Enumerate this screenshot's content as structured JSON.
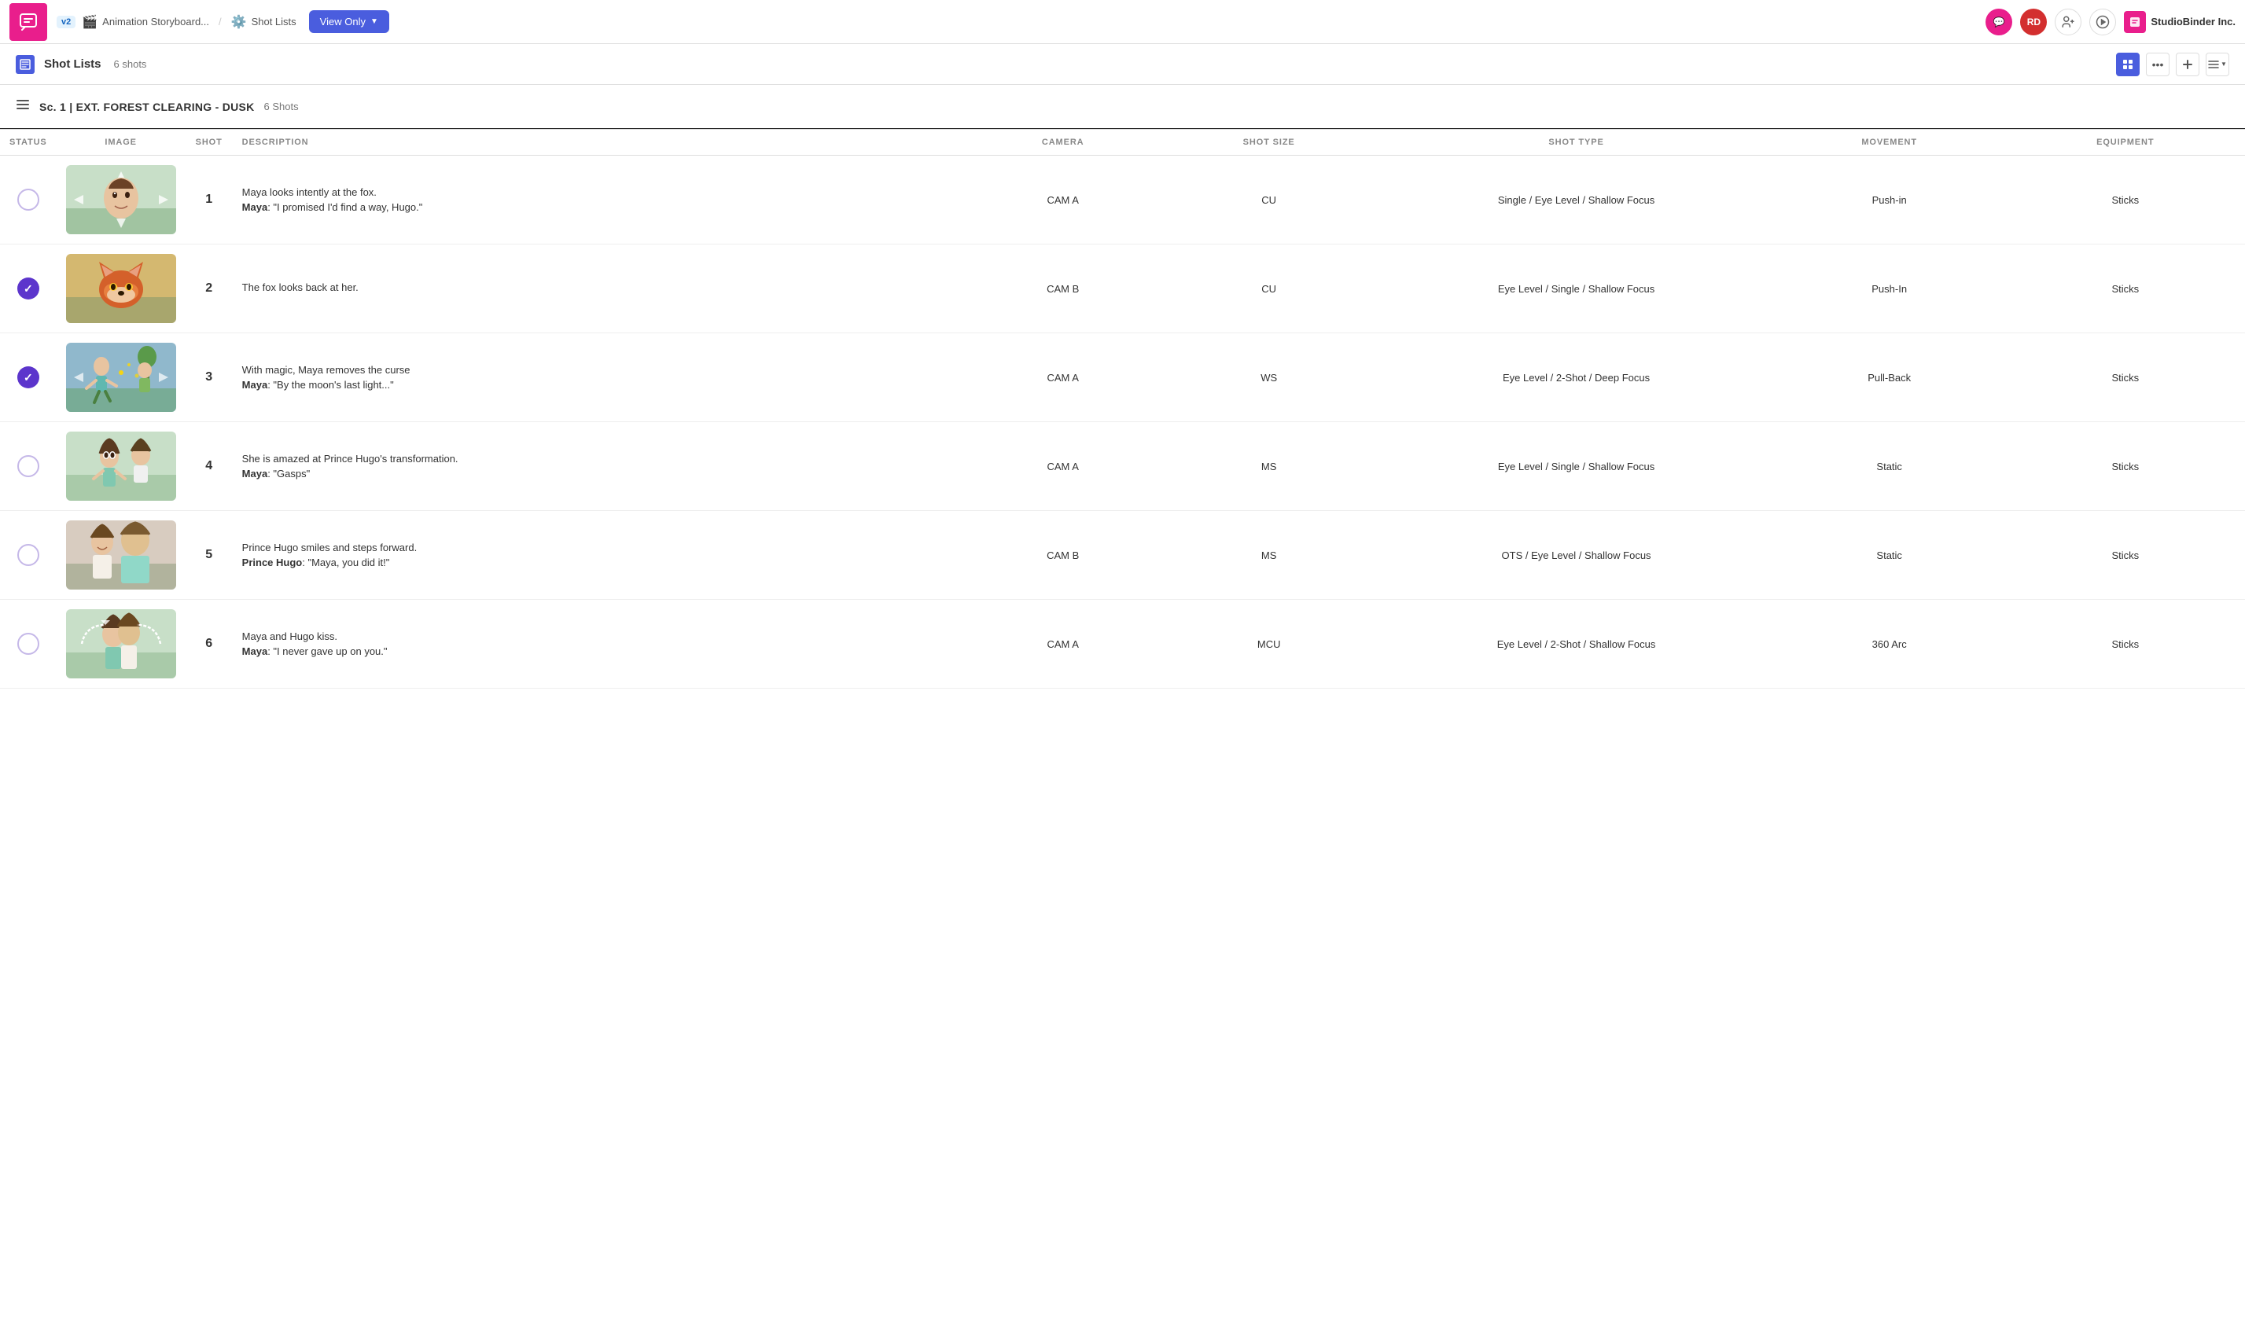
{
  "app": {
    "icon": "💬",
    "version": "v2",
    "project_name": "Animation Storyboard...",
    "nav_shot_lists": "Shot Lists",
    "view_only_label": "View Only",
    "user_initials_1": "RD",
    "studio_binder": "StudioBinder Inc."
  },
  "sub_header": {
    "title": "Shot Lists",
    "count": "6 shots"
  },
  "scene": {
    "number": "Sc. 1",
    "location": "EXT. FOREST CLEARING - DUSK",
    "shot_count": "6 Shots"
  },
  "columns": {
    "status": "STATUS",
    "image": "IMAGE",
    "shot": "SHOT",
    "description": "DESCRIPTION",
    "camera": "CAMERA",
    "shot_size": "SHOT SIZE",
    "shot_type": "SHOT TYPE",
    "movement": "MOVEMENT",
    "equipment": "EQUIPMENT"
  },
  "shots": [
    {
      "id": 1,
      "status": "empty",
      "shot_number": "1",
      "description_main": "Maya looks intently at the fox.",
      "description_dialog_speaker": "Maya",
      "description_dialog_text": ": \"I promised I'd find a way, Hugo.\"",
      "camera": "CAM A",
      "shot_size": "CU",
      "shot_type": "Single / Eye Level / Shallow Focus",
      "movement": "Push-in",
      "equipment": "Sticks",
      "image_class": "img1"
    },
    {
      "id": 2,
      "status": "done",
      "shot_number": "2",
      "description_main": "The fox looks back at her.",
      "description_dialog_speaker": "",
      "description_dialog_text": "",
      "camera": "CAM B",
      "shot_size": "CU",
      "shot_type": "Eye Level / Single / Shallow Focus",
      "movement": "Push-In",
      "equipment": "Sticks",
      "image_class": "img2"
    },
    {
      "id": 3,
      "status": "done",
      "shot_number": "3",
      "description_main": "With magic, Maya removes the curse",
      "description_dialog_speaker": "Maya",
      "description_dialog_text": ": \"By the moon's last light...\"",
      "camera": "CAM A",
      "shot_size": "WS",
      "shot_type": "Eye Level / 2-Shot / Deep Focus",
      "movement": "Pull-Back",
      "equipment": "Sticks",
      "image_class": "img3"
    },
    {
      "id": 4,
      "status": "empty",
      "shot_number": "4",
      "description_main": "She is amazed at Prince Hugo's transformation.",
      "description_dialog_speaker": "Maya",
      "description_dialog_text": ": \"Gasps\"",
      "camera": "CAM A",
      "shot_size": "MS",
      "shot_type": "Eye Level / Single / Shallow Focus",
      "movement": "Static",
      "equipment": "Sticks",
      "image_class": "img4"
    },
    {
      "id": 5,
      "status": "empty",
      "shot_number": "5",
      "description_main": "Prince Hugo smiles and steps forward.",
      "description_dialog_speaker": "Prince Hugo",
      "description_dialog_text": ": \"Maya, you did it!\"",
      "camera": "CAM B",
      "shot_size": "MS",
      "shot_type": "OTS / Eye Level / Shallow Focus",
      "movement": "Static",
      "equipment": "Sticks",
      "image_class": "img5"
    },
    {
      "id": 6,
      "status": "empty",
      "shot_number": "6",
      "description_main": "Maya and Hugo kiss.",
      "description_dialog_speaker": "Maya",
      "description_dialog_text": ": \"I never gave up on you.\"",
      "camera": "CAM A",
      "shot_size": "MCU",
      "shot_type": "Eye Level / 2-Shot / Shallow Focus",
      "movement": "360 Arc",
      "equipment": "Sticks",
      "image_class": "img6"
    }
  ]
}
